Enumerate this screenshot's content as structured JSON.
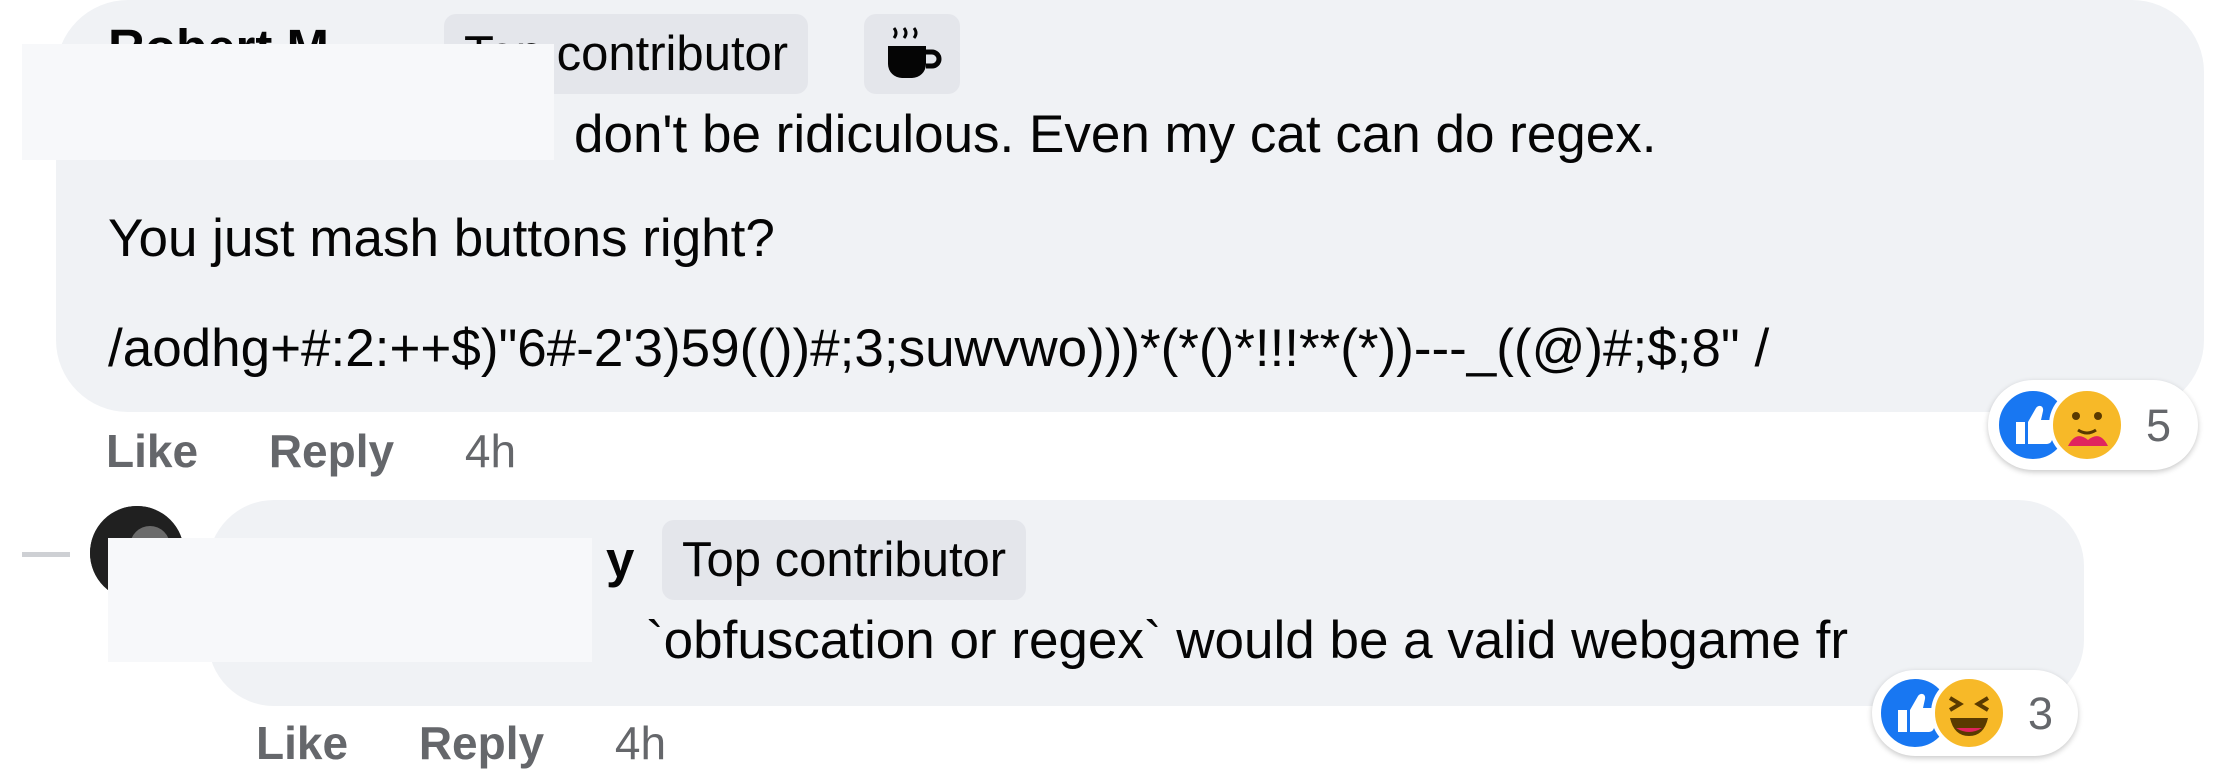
{
  "comment1": {
    "author": "Robert M",
    "badge": "Top contributor",
    "badge_icon": "coffee-cup-icon",
    "line1": "don't be ridiculous. Even my cat can do regex.",
    "line2": "You just mash buttons right?",
    "line3": "/aodhg+#:2:++$)\"6#-2'3)59(())#;3;suwvwo)))*(*()*!!!**(*))---_((@)#;$;8\" /",
    "reactions": [
      "like-icon",
      "care-icon"
    ],
    "reaction_count": "5",
    "actions": {
      "like": "Like",
      "reply": "Reply",
      "time": "4h"
    }
  },
  "comment2": {
    "author_tail": "y",
    "badge": "Top contributor",
    "line1": "`obfuscation or regex` would be a valid webgame fr",
    "reactions": [
      "like-icon",
      "haha-icon"
    ],
    "reaction_count": "3",
    "actions": {
      "like": "Like",
      "reply": "Reply",
      "time": "4h"
    }
  },
  "colors": {
    "bubble": "#f0f2f5",
    "badge": "#e4e6eb",
    "meta_text": "#65676b",
    "like_blue": "#1877f2",
    "emoji_yellow": "#f7b928"
  }
}
